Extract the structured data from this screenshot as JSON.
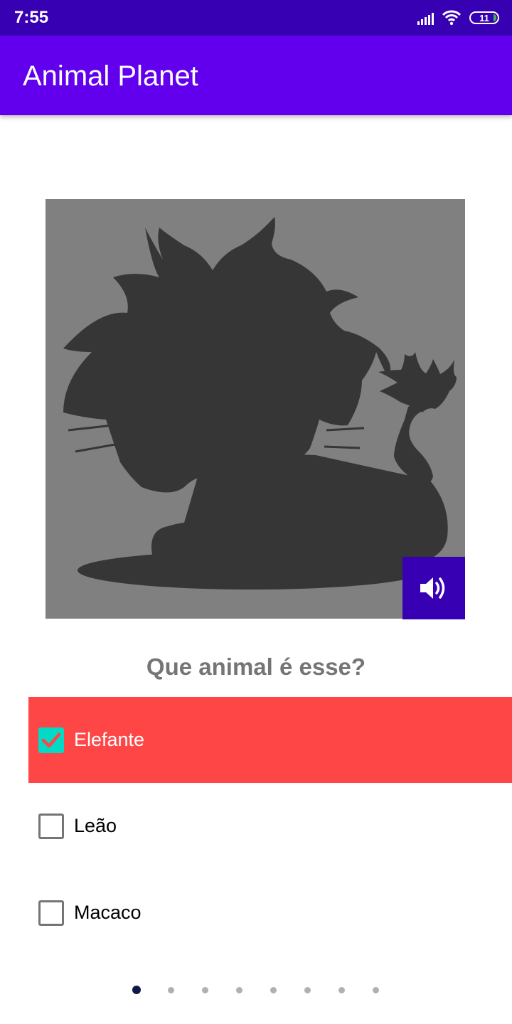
{
  "status_bar": {
    "time": "7:55",
    "battery": "11",
    "icons": [
      "signal-icon",
      "wifi-icon",
      "battery-icon"
    ]
  },
  "app_bar": {
    "title": "Animal Planet"
  },
  "quiz": {
    "image_icon": "lion-silhouette",
    "sound_icon": "volume-icon",
    "question": "Que animal é esse?",
    "options": [
      {
        "label": "Elefante",
        "checked": true,
        "highlight": "#ff4646"
      },
      {
        "label": "Leão",
        "checked": false
      },
      {
        "label": "Macaco",
        "checked": false
      }
    ]
  },
  "pager": {
    "total": 8,
    "current": 1
  },
  "colors": {
    "status_bar": "#3700b3",
    "app_bar": "#6200ee",
    "checkbox_checked": "#03dac5",
    "selected_option": "#ff4646"
  }
}
